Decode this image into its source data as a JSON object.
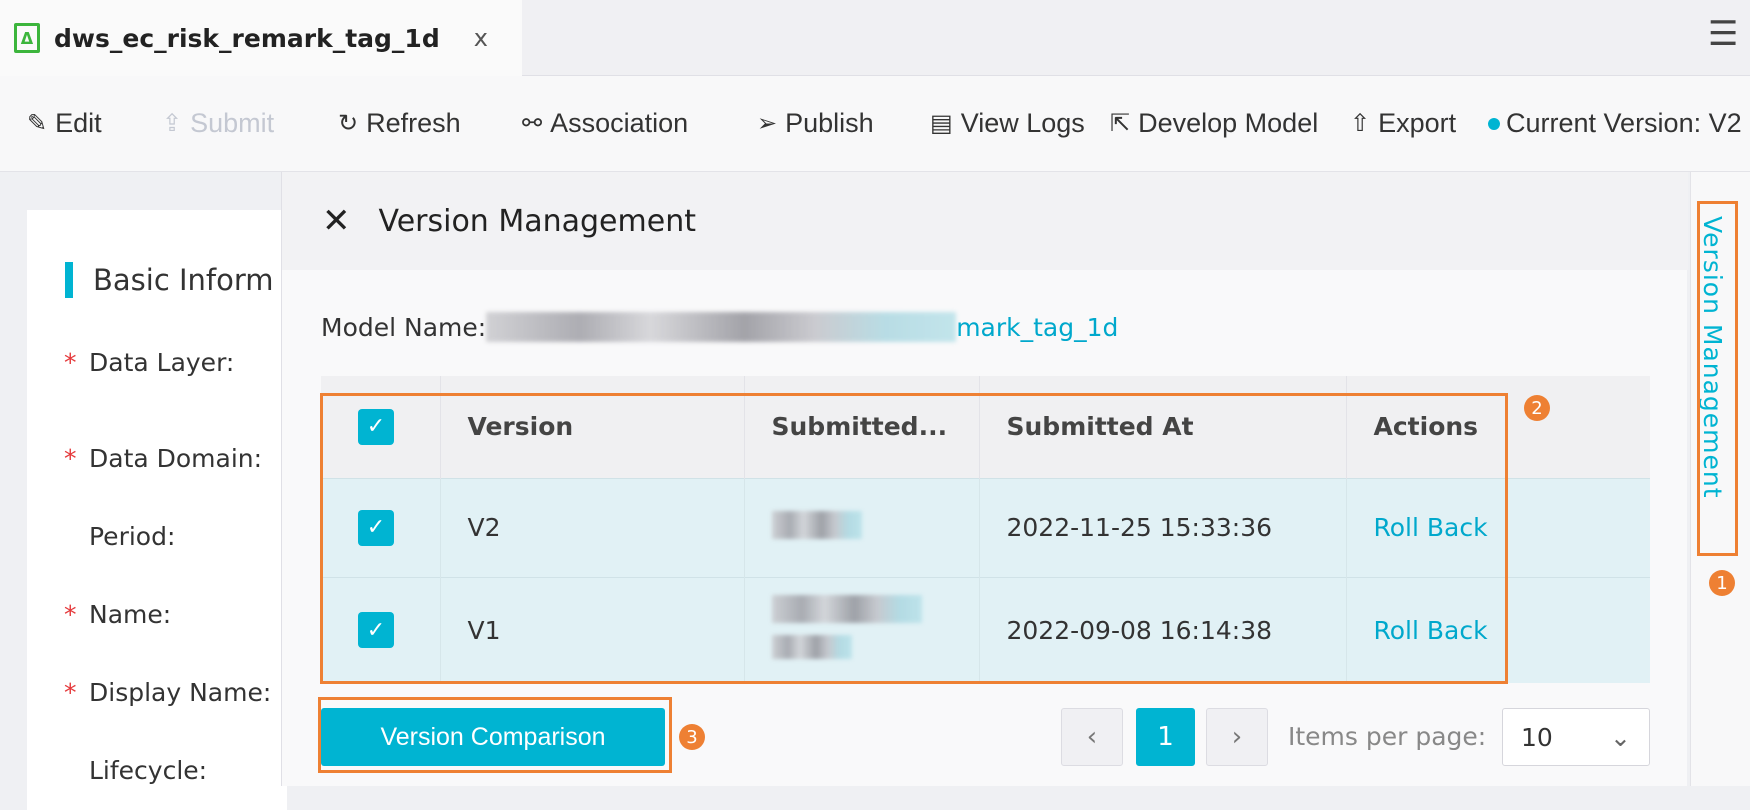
{
  "tab": {
    "title": "dws_ec_risk_remark_tag_1d",
    "close": "x",
    "icon": "model-icon"
  },
  "menu_icon": "☰",
  "toolbar": {
    "edit": "Edit",
    "submit": "Submit",
    "refresh": "Refresh",
    "association": "Association",
    "publish": "Publish",
    "view_logs": "View Logs",
    "develop_model": "Develop Model",
    "export": "Export",
    "current_version": "Current Version: V2"
  },
  "form": {
    "section": "Basic Inform",
    "labels": [
      "Data Layer:",
      "Data Domain:",
      "Period:",
      "Name:",
      "Display Name:",
      "Lifecycle:"
    ],
    "required": [
      true,
      true,
      false,
      true,
      true,
      false
    ]
  },
  "drawer": {
    "title": "Version Management",
    "model_name_label": "Model Name:",
    "model_name_visible": "mark_tag_1d",
    "columns": [
      "Version",
      "Submitted...",
      "Submitted At",
      "Actions"
    ],
    "rows": [
      {
        "version": "V2",
        "submitted_at": "2022-11-25 15:33:36",
        "action": "Roll Back",
        "checked": true
      },
      {
        "version": "V1",
        "submitted_at": "2022-09-08 16:14:38",
        "action": "Roll Back",
        "checked": true
      }
    ],
    "compare_button": "Version Comparison",
    "pagination": {
      "prev": "‹",
      "page": "1",
      "next": "›",
      "items_label": "Items per page:",
      "items_value": "10"
    }
  },
  "side_tab": "Version Management",
  "callouts": [
    "1",
    "2",
    "3"
  ],
  "colors": {
    "accent": "#00b4d2",
    "callout": "#ee8033",
    "required": "#e5393b"
  }
}
